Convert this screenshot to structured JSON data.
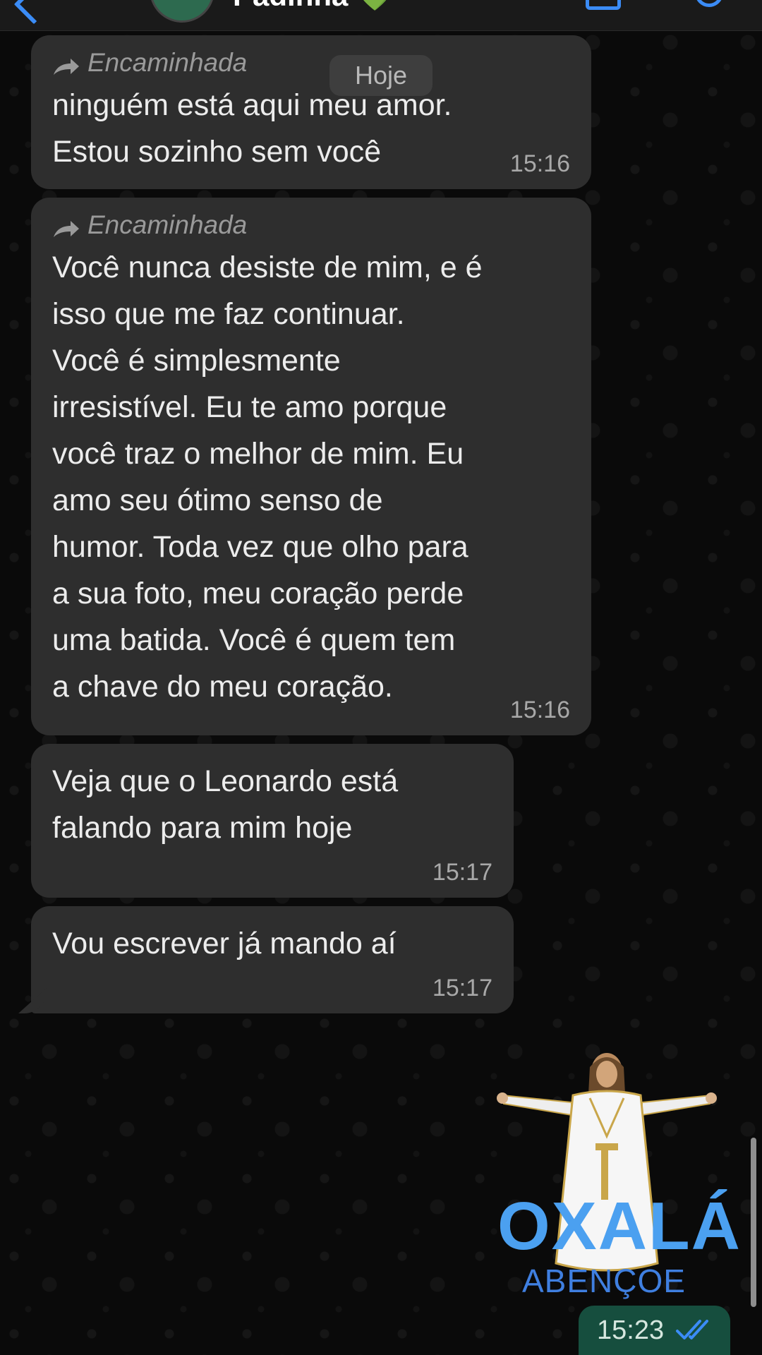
{
  "header": {
    "contact_name": "Padinha 💚"
  },
  "date_separator": "Hoje",
  "messages": [
    {
      "forwarded_label": "Encaminhada",
      "text": "ninguém está aqui meu amor.\nEstou sozinho sem você",
      "time": "15:16"
    },
    {
      "forwarded_label": "Encaminhada",
      "text": "Você nunca desiste de mim, e é\nisso que me faz continuar.\nVocê é simplesmente\nirresistível.  Eu te amo porque\nvocê traz o melhor de mim.  Eu\namo seu ótimo senso de\nhumor.  Toda vez que olho para\na sua foto, meu coração perde\numa batida.  Você é quem tem\na chave do meu coração.",
      "time": "15:16"
    },
    {
      "text": "Veja que o Leonardo está\nfalando para mim hoje",
      "time": "15:17"
    },
    {
      "text": "Vou escrever já mando aí",
      "time": "15:17"
    }
  ],
  "sticker": {
    "title": "OXALÁ",
    "subtitle": "ABENÇOE",
    "time": "15:23"
  },
  "colors": {
    "bubble_in": "#2e2e2e",
    "accent_blue": "#3b8cf6",
    "sent_green": "#164e3e"
  }
}
